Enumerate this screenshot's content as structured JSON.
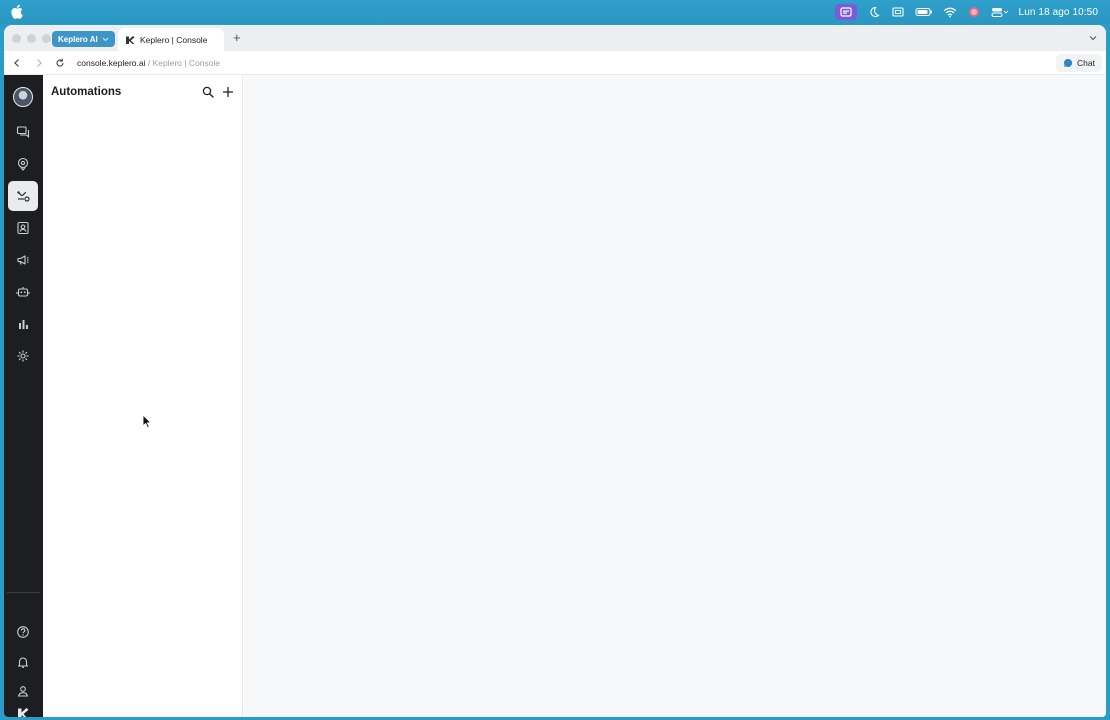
{
  "menubar": {
    "clock": "Lun 18 ago  10:50"
  },
  "browser": {
    "tab_group_label": "Keplero AI",
    "active_tab_title": "Keplero | Console",
    "url_host": "console.keplero.ai",
    "url_separator": " / ",
    "url_page_title": "Keplero | Console",
    "chat_label": "Chat"
  },
  "sidebar": {
    "items": [
      {
        "name": "conversations",
        "icon": "chat-bubbles-icon"
      },
      {
        "name": "knowledge",
        "icon": "location-pin-icon"
      },
      {
        "name": "automations",
        "icon": "workflow-icon",
        "active": true
      },
      {
        "name": "contacts",
        "icon": "contact-card-icon"
      },
      {
        "name": "campaigns",
        "icon": "megaphone-icon"
      },
      {
        "name": "agents",
        "icon": "robot-icon"
      },
      {
        "name": "analytics",
        "icon": "bar-chart-icon"
      },
      {
        "name": "settings",
        "icon": "gear-icon"
      }
    ],
    "bottom_items": [
      {
        "name": "help",
        "icon": "help-circle-icon"
      },
      {
        "name": "notifications",
        "icon": "bell-icon"
      },
      {
        "name": "profile",
        "icon": "user-icon"
      }
    ]
  },
  "panel": {
    "title": "Automations"
  },
  "colors": {
    "rail_bg": "#1c1e22",
    "accent": "#3d96c6",
    "content_bg": "#f7f8fa"
  }
}
